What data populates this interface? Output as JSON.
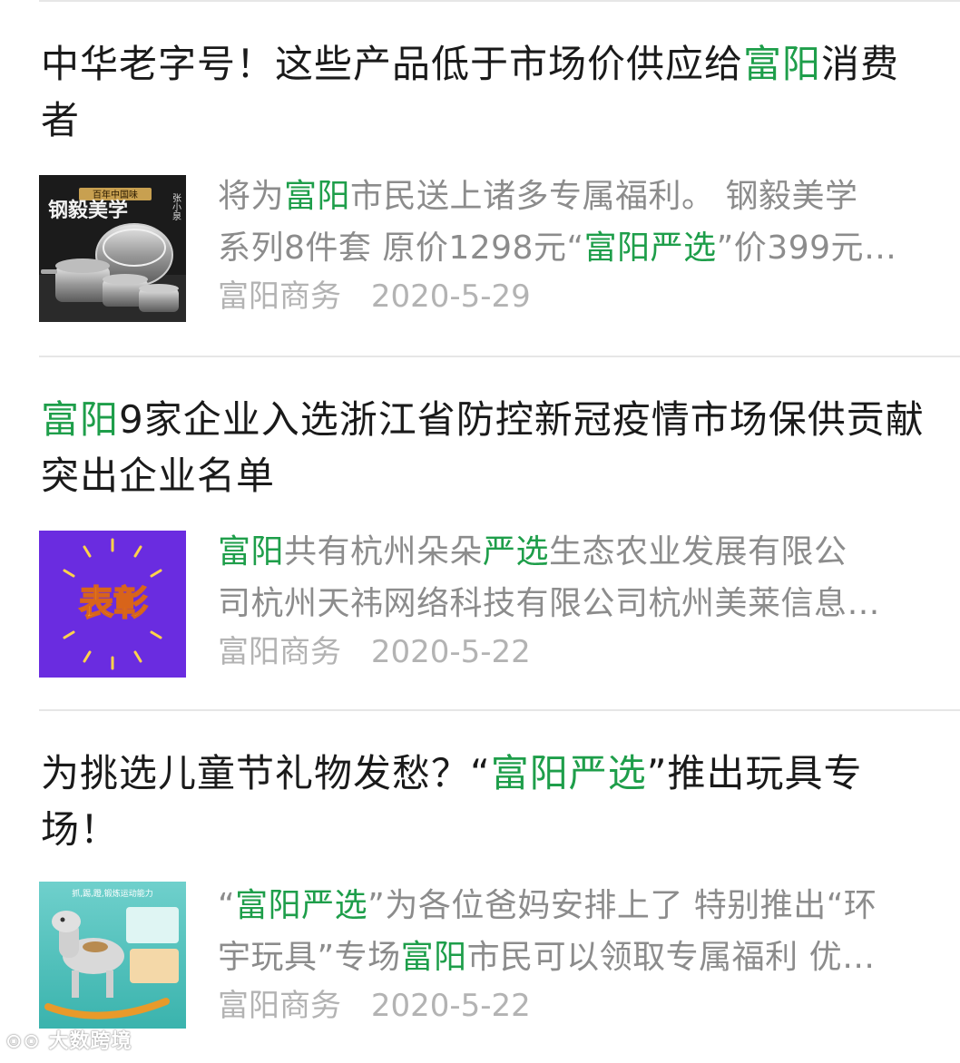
{
  "articles": [
    {
      "title": [
        "中华老字号！这些产品低于市场价供应给",
        {
          "hl": "富阳"
        },
        "消费者"
      ],
      "summary_lines": [
        [
          "将为",
          {
            "hl": "富阳"
          },
          "市民送上诸多专属福利。 钢毅美学"
        ],
        [
          "系列8件套 原价1298元“",
          {
            "hl": "富阳严选"
          },
          "”价399元…"
        ]
      ],
      "source": "富阳商务",
      "date": "2020-5-29",
      "thumb": {
        "name": "cookware-set-thumbnail",
        "title_text": "钢毅美学",
        "badge_text": "百年中国味",
        "brand_text": "张小泉"
      }
    },
    {
      "title": [
        {
          "hl": "富阳"
        },
        "9家企业入选浙江省防控新冠疫情市场保供贡献突出企业名单"
      ],
      "summary_lines": [
        [
          {
            "hl": "富阳"
          },
          "共有杭州朵朵",
          {
            "hl": "严选"
          },
          "生态农业发展有限公"
        ],
        [
          "司杭州天祎网络科技有限公司杭州美莱信息…"
        ]
      ],
      "source": "富阳商务",
      "date": "2020-5-22",
      "thumb": {
        "name": "commendation-thumbnail",
        "title_text": "表彰"
      }
    },
    {
      "title": [
        "为挑选儿童节礼物发愁？“",
        {
          "hl": "富阳严选"
        },
        "”推出玩具专场！"
      ],
      "summary_lines": [
        [
          "“",
          {
            "hl": "富阳严选"
          },
          "”为各位爸妈安排上了 特别推出“环"
        ],
        [
          "宇玩具”专场",
          {
            "hl": "富阳"
          },
          "市民可以领取专属福利 优…"
        ]
      ],
      "source": "富阳商务",
      "date": "2020-5-22",
      "thumb": {
        "name": "rocking-horse-toy-thumbnail",
        "title_text": "抓,踢,蹬,锻炼运动能力"
      }
    }
  ],
  "watermark": "大数跨境",
  "colors": {
    "highlight": "#1e9e4a",
    "meta": "#b3b3b3",
    "summary": "#8c8c8c",
    "title": "#1a1a1a",
    "purple": "#6a2ce0"
  }
}
